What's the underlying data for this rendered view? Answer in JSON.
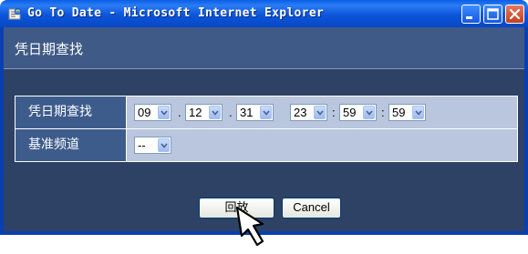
{
  "window": {
    "title": "Go To Date - Microsoft Internet Explorer"
  },
  "page": {
    "title": "凭日期查找"
  },
  "form": {
    "rows": [
      {
        "label": "凭日期查找",
        "values": [
          "09",
          "12",
          "31",
          "23",
          "59",
          "59"
        ],
        "separators": [
          ".",
          ".",
          ":",
          ":"
        ]
      },
      {
        "label": "基准频道",
        "values": [
          "--"
        ]
      }
    ]
  },
  "buttons": {
    "play_label": "回放",
    "cancel_label": "Cancel"
  },
  "colors": {
    "titlebar": "#0c55da",
    "page_bg": "#2d4264",
    "header_bg": "#3f5a86",
    "row_label_bg": "#3d5c8c",
    "row_value_bg": "#b9c6de"
  },
  "icons": [
    "ie-icon",
    "minimize-icon",
    "maximize-icon",
    "close-icon",
    "chevron-down-icon",
    "pointer-cursor-icon"
  ]
}
